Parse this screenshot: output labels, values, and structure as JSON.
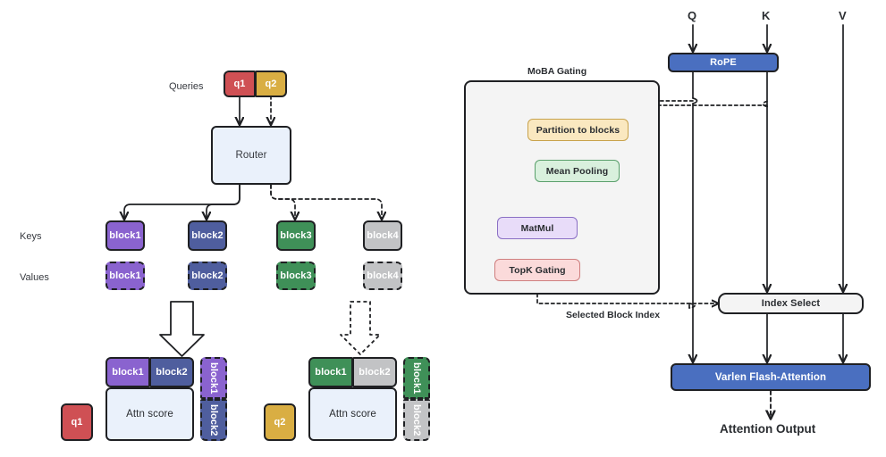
{
  "title": "MoBA (Mixture of Block Attention) architecture diagram",
  "left_panel": {
    "row_labels": {
      "queries": "Queries",
      "keys": "Keys",
      "values": "Values"
    },
    "queries": [
      {
        "name": "q1",
        "color": "#cf5054",
        "text_color": "#ffffff"
      },
      {
        "name": "q2",
        "color": "#d9ae43",
        "text_color": "#ffffff"
      }
    ],
    "router": {
      "label": "Router",
      "fill": "#eaf1fb",
      "border": "#1f2023"
    },
    "key_blocks": [
      {
        "label": "block1",
        "color": "#8a63cf"
      },
      {
        "label": "block2",
        "color": "#4f5e9e"
      },
      {
        "label": "block3",
        "color": "#3f9058"
      },
      {
        "label": "block4",
        "color": "#c2c3c5"
      }
    ],
    "value_blocks": [
      {
        "label": "block1",
        "color": "#8a63cf"
      },
      {
        "label": "block2",
        "color": "#4f5e9e"
      },
      {
        "label": "block3",
        "color": "#3f9058"
      },
      {
        "label": "block4",
        "color": "#c2c3c5"
      }
    ],
    "attn_groups": [
      {
        "query": {
          "label": "q1",
          "color": "#cf5054"
        },
        "attn_label": "Attn score",
        "attn_fill": "#eaf1fb",
        "top_keys": [
          {
            "label": "block1",
            "color": "#8a63cf"
          },
          {
            "label": "block2",
            "color": "#4f5e9e"
          }
        ],
        "side_values": [
          {
            "label": "block1",
            "color": "#8a63cf"
          },
          {
            "label": "block2",
            "color": "#4f5e9e"
          }
        ]
      },
      {
        "query": {
          "label": "q2",
          "color": "#d9ae43"
        },
        "attn_label": "Attn score",
        "attn_fill": "#eaf1fb",
        "top_keys": [
          {
            "label": "block1",
            "color": "#3f9058"
          },
          {
            "label": "block2",
            "color": "#c2c3c5"
          }
        ],
        "side_values": [
          {
            "label": "block1",
            "color": "#3f9058"
          },
          {
            "label": "block2",
            "color": "#c2c3c5"
          }
        ]
      }
    ]
  },
  "right_panel": {
    "inputs": [
      {
        "label": "Q"
      },
      {
        "label": "K"
      },
      {
        "label": "V"
      }
    ],
    "rope": {
      "label": "RoPE",
      "fill": "#4a6fc0",
      "text_color": "#ffffff"
    },
    "gating_group": {
      "title": "MoBA Gating",
      "fill": "#f4f4f4",
      "nodes": [
        {
          "label": "Partition to blocks",
          "fill": "#fae8c0",
          "border": "#c8a24c"
        },
        {
          "label": "Mean Pooling",
          "fill": "#d9f0dd",
          "border": "#5aa06c"
        },
        {
          "label": "MatMul",
          "fill": "#e8dcf9",
          "border": "#8a6fc4"
        },
        {
          "label": "TopK Gating",
          "fill": "#fbdada",
          "border": "#cf7f7f"
        }
      ]
    },
    "selected_block_index_label": "Selected Block Index",
    "index_select": {
      "label": "Index Select",
      "fill": "#f4f4f4",
      "text_color": "#2a2d31"
    },
    "varlen": {
      "label": "Varlen Flash-Attention",
      "fill": "#4a6fc0",
      "text_color": "#ffffff"
    },
    "output_label": "Attention Output"
  },
  "colors": {
    "stroke": "#1f2023",
    "purple": "#8a63cf",
    "blue": "#4f5e9e",
    "green": "#3f9058",
    "grey": "#c2c3c5",
    "red": "#cf5054",
    "gold": "#d9ae43",
    "accent_blue": "#4a6fc0",
    "panel_grey": "#f4f4f4",
    "pale_blue": "#eaf1fb"
  }
}
